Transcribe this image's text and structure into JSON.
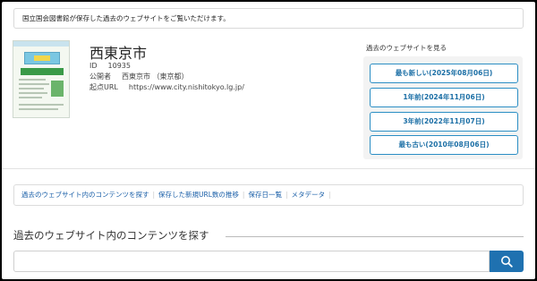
{
  "notice": "国立国会図書館が保存した過去のウェブサイトをご覧いただけます。",
  "site": {
    "name": "西東京市",
    "id_label": "ID",
    "id_value": "10935",
    "publisher_label": "公開者",
    "publisher_value": "西東京市 （東京都）",
    "origin_label": "起点URL",
    "origin_value": "https://www.city.nishitokyo.lg.jp/"
  },
  "sidebar": {
    "title": "過去のウェブサイトを見る",
    "buttons": [
      "最も新しい(2025年08月06日)",
      "1年前(2024年11月06日)",
      "3年前(2022年11月07日)",
      "最も古い(2010年08月06日)"
    ]
  },
  "tabs": [
    "過去のウェブサイト内のコンテンツを探す",
    "保存した新規URL数の推移",
    "保存日一覧",
    "メタデータ"
  ],
  "search": {
    "title": "過去のウェブサイト内のコンテンツを探す",
    "placeholder": "",
    "icon": "search-icon",
    "button_color": "#1f71b0"
  }
}
